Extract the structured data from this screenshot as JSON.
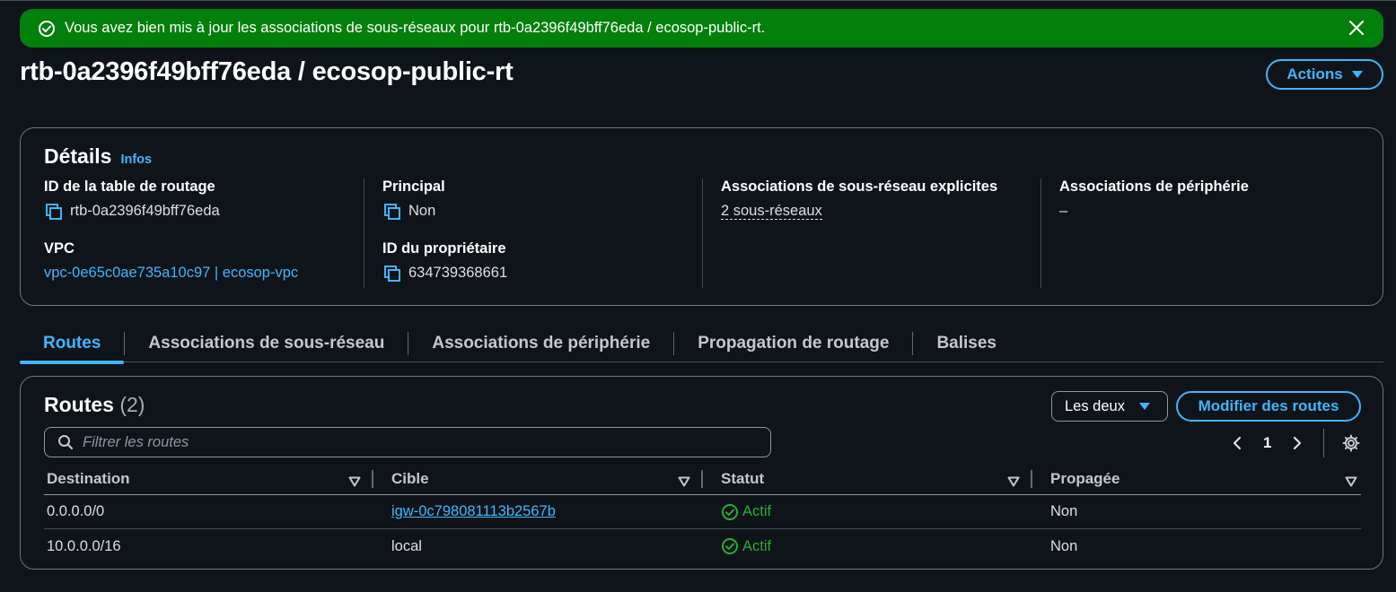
{
  "flash": {
    "message": "Vous avez bien mis à jour les associations de sous-réseaux pour rtb-0a2396f49bff76eda / ecosop-public-rt."
  },
  "header": {
    "title": "rtb-0a2396f49bff76eda / ecosop-public-rt",
    "actions_label": "Actions"
  },
  "details": {
    "heading": "Détails",
    "info_link": "Infos",
    "route_table_id_label": "ID de la table de routage",
    "route_table_id": "rtb-0a2396f49bff76eda",
    "vpc_label": "VPC",
    "vpc_value": "vpc-0e65c0ae735a10c97 | ecosop-vpc",
    "main_label": "Principal",
    "main_value": "Non",
    "owner_label": "ID du propriétaire",
    "owner_value": "634739368661",
    "subnet_assoc_label": "Associations de sous-réseau explicites",
    "subnet_assoc_value": "2 sous-réseaux",
    "edge_assoc_label": "Associations de périphérie",
    "edge_assoc_value": "–"
  },
  "tabs": [
    {
      "label": "Routes",
      "active": true
    },
    {
      "label": "Associations de sous-réseau",
      "active": false
    },
    {
      "label": "Associations de périphérie",
      "active": false
    },
    {
      "label": "Propagation de routage",
      "active": false
    },
    {
      "label": "Balises",
      "active": false
    }
  ],
  "routes": {
    "title": "Routes",
    "count": "(2)",
    "filter_select": "Les deux",
    "modify_label": "Modifier des routes",
    "filter_placeholder": "Filtrer les routes",
    "page": "1",
    "columns": [
      "Destination",
      "Cible",
      "Statut",
      "Propagée"
    ],
    "rows": [
      {
        "destination": "0.0.0.0/0",
        "target": "igw-0c798081113b2567b",
        "status": "Actif",
        "propagated": "Non"
      },
      {
        "destination": "10.0.0.0/16",
        "target": "local",
        "status": "Actif",
        "propagated": "Non"
      }
    ]
  },
  "colors": {
    "accent": "#42b4ff",
    "success_banner": "#037f0c",
    "status_ok": "#29ad32",
    "background": "#0f141a"
  }
}
